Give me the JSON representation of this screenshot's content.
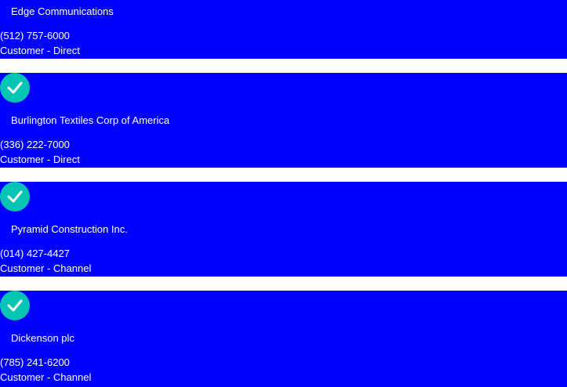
{
  "accounts": [
    {
      "name": "Edge Communications",
      "phone": "(512) 757-6000",
      "type": "Customer - Direct"
    },
    {
      "name": "Burlington Textiles Corp of America",
      "phone": "(336) 222-7000",
      "type": "Customer - Direct",
      "icon": "check-icon"
    },
    {
      "name": "Pyramid Construction Inc.",
      "phone": "(014) 427-4427",
      "type": "Customer - Channel",
      "icon": "check-icon"
    },
    {
      "name": "Dickenson plc",
      "phone": "(785) 241-6200",
      "type": "Customer - Channel",
      "icon": "check-icon"
    }
  ],
  "colors": {
    "card_background": "#0000ff",
    "check_background": "#04c4b4",
    "text": "#ffffff"
  }
}
